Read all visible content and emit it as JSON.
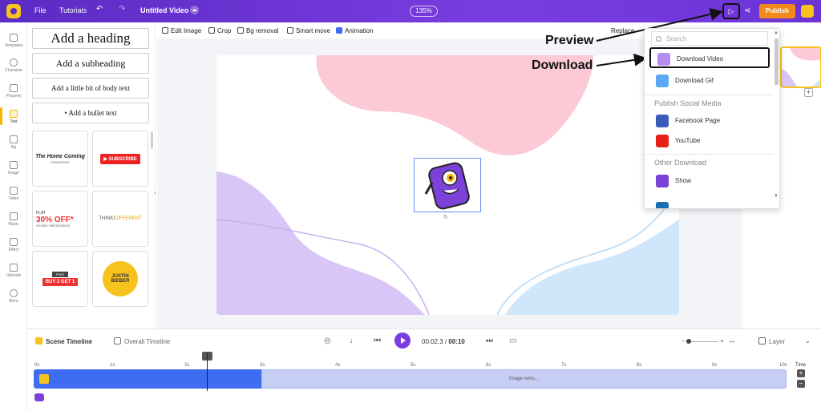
{
  "topbar": {
    "file": "File",
    "tutorials": "Tutorials",
    "title": "Untitled Video",
    "zoom": "135%",
    "publish": "Publish"
  },
  "rail": [
    "Templates",
    "Character",
    "Property",
    "Text",
    "Bg",
    "Image",
    "Video",
    "Music",
    "Effect",
    "Uploads",
    "More"
  ],
  "panel": {
    "heading": "Add a heading",
    "subheading": "Add a subheading",
    "body": "Add a little bit of body text",
    "bullet": "Add a bullet text",
    "templates": [
      {
        "line1": "The Home Coming",
        "line2": "#TRUESTORY"
      },
      {
        "line1": "SUBSCRIBE",
        "line2": ""
      },
      {
        "line1": "FLAT",
        "line2": "30% OFF*",
        "line3": "ON EARLY BIRD BOOKINGS"
      },
      {
        "line1": "THINK/",
        "line2": "DIFFERENT"
      },
      {
        "line1": "FREE",
        "line2": "BUY 2 GET 1"
      },
      {
        "line1": "JUSTIN",
        "line2": "BIEBER"
      }
    ]
  },
  "toolbar": {
    "edit_image": "Edit Image",
    "crop": "Crop",
    "bg_removal": "Bg removal",
    "smart_move": "Smart move",
    "animation": "Animation",
    "replace": "Replace"
  },
  "dropdown": {
    "search_placeholder": "Search",
    "download_video": "Download Video",
    "download_gif": "Download Gif",
    "publish_social": "Publish Social Media",
    "facebook": "Facebook Page",
    "youtube": "YouTube",
    "other_download": "Other Download",
    "show": "Show"
  },
  "annotations": {
    "preview": "Preview",
    "download": "Download"
  },
  "timeline": {
    "scene_timeline": "Scene Timeline",
    "overall_timeline": "Overall Timeline",
    "current_time": "00:02.3",
    "separator": "/",
    "total_time": "00:10",
    "layer": "Layer",
    "time_label": "Time",
    "track_label": "Image remo...",
    "ruler": [
      "0s",
      "1s",
      "2s",
      "3s",
      "4s",
      "5s",
      "6s",
      "7s",
      "8s",
      "9s",
      "10s"
    ]
  },
  "colors": {
    "topbar": "#6a34d6",
    "accent": "#7a3de0",
    "publish": "#f08a1c",
    "pink_shape": "#fcc9d6",
    "purple_shape": "#d9c6f7",
    "blue_shape": "#cfe6fb",
    "track_blue": "#3e6df2"
  }
}
